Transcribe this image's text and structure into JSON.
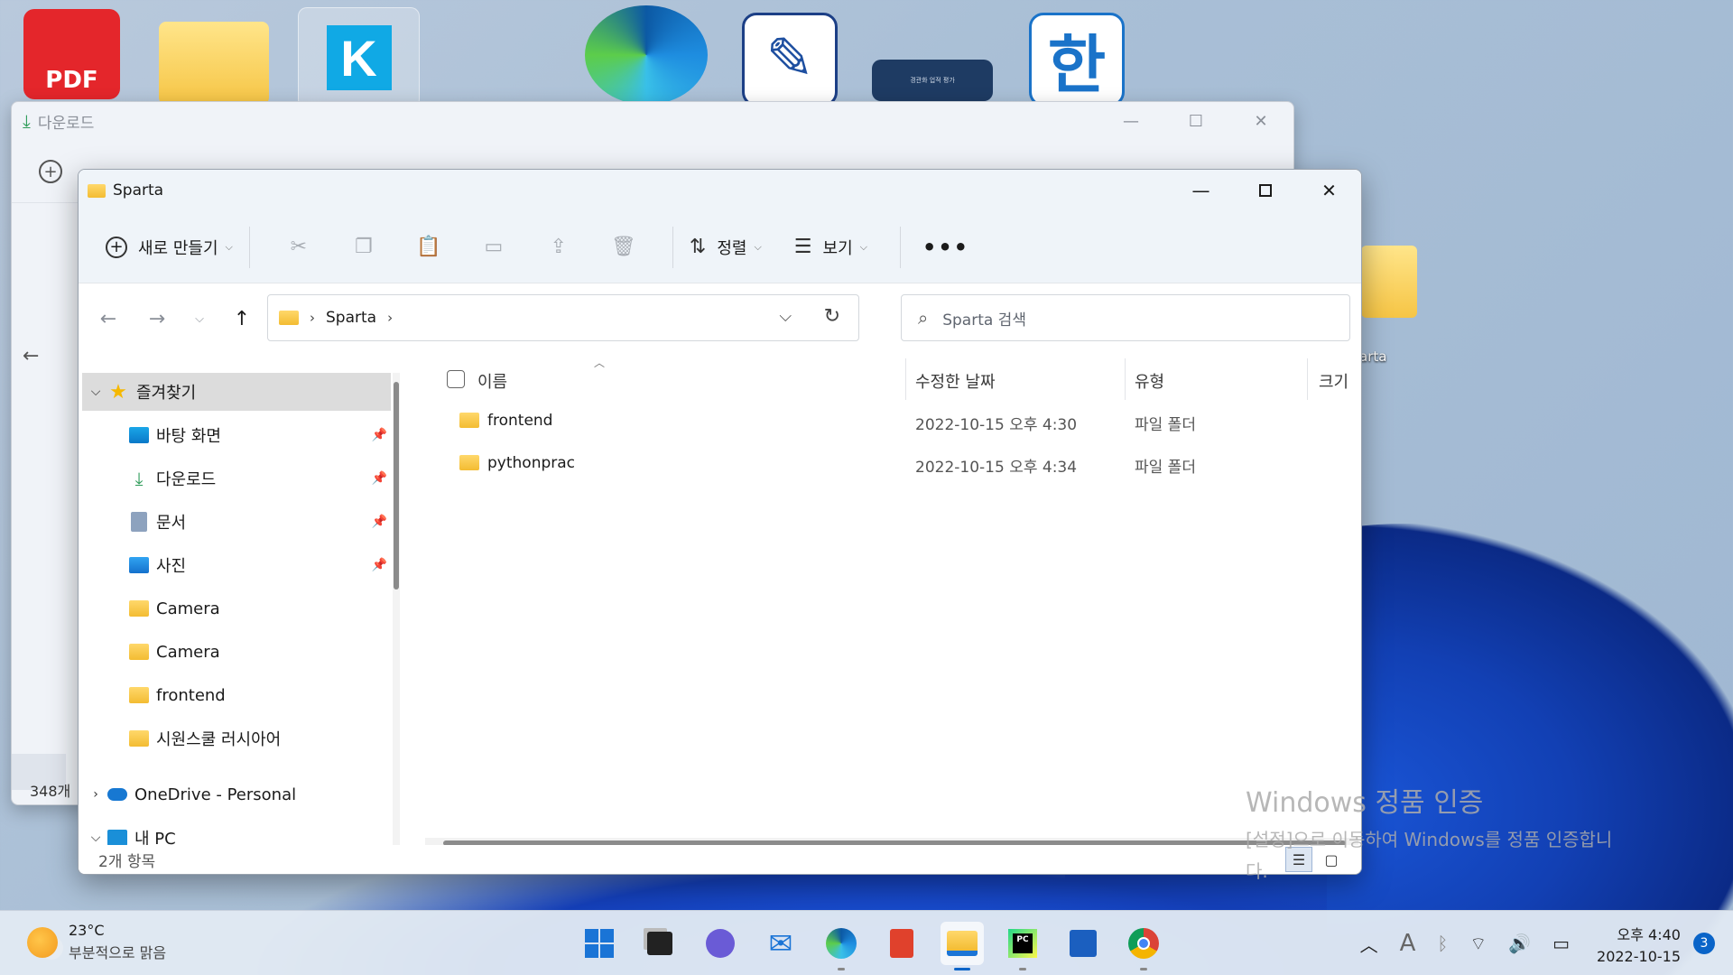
{
  "desktop": {
    "icons": [
      {
        "name": "pdf-app",
        "label": "PDF"
      },
      {
        "name": "folder"
      },
      {
        "name": "k-app",
        "label": "K"
      },
      {
        "name": "edge"
      },
      {
        "name": "notepad"
      },
      {
        "name": "doc-thumbnail",
        "label": "경관화 업적 평가"
      },
      {
        "name": "hancom",
        "label": "한"
      }
    ],
    "sparta_folder_label": "arta"
  },
  "back_window": {
    "title": "다운로드",
    "item_count": "348개"
  },
  "window": {
    "title": "Sparta",
    "command_bar": {
      "new_label": "새로 만들기",
      "sort_label": "정렬",
      "view_label": "보기",
      "more_label": "•••"
    },
    "address": {
      "crumbs": [
        "Sparta"
      ],
      "search_placeholder": "Sparta 검색"
    },
    "nav_pane": {
      "favorites_label": "즐겨찾기",
      "items": [
        {
          "label": "바탕 화면",
          "icon": "desktop-icon",
          "pinned": true
        },
        {
          "label": "다운로드",
          "icon": "download-icon",
          "pinned": true
        },
        {
          "label": "문서",
          "icon": "documents-icon",
          "pinned": true
        },
        {
          "label": "사진",
          "icon": "pictures-icon",
          "pinned": true
        },
        {
          "label": "Camera",
          "icon": "folder-icon",
          "pinned": false
        },
        {
          "label": "Camera",
          "icon": "folder-icon",
          "pinned": false
        },
        {
          "label": "frontend",
          "icon": "folder-icon",
          "pinned": false
        },
        {
          "label": "시원스쿨 러시아어",
          "icon": "folder-icon",
          "pinned": false
        }
      ],
      "onedrive_label": "OneDrive - Personal",
      "pc_label": "내 PC"
    },
    "columns": {
      "name": "이름",
      "modified": "수정한 날짜",
      "type": "유형",
      "size": "크기"
    },
    "files": [
      {
        "name": "frontend",
        "modified": "2022-10-15 오후 4:30",
        "type": "파일 폴더",
        "size": ""
      },
      {
        "name": "pythonprac",
        "modified": "2022-10-15 오후 4:34",
        "type": "파일 폴더",
        "size": ""
      }
    ],
    "status": "2개 항목"
  },
  "watermark": {
    "line1": "Windows 정품 인증",
    "line2": "[설정]으로 이동하여 Windows를 정품 인증합니",
    "line3": "다."
  },
  "taskbar": {
    "weather_temp": "23°C",
    "weather_desc": "부분적으로 맑음",
    "apps": [
      "start-icon",
      "task-view-icon",
      "chat-icon",
      "mail-icon",
      "edge-icon",
      "office-icon",
      "file-explorer-icon",
      "pycharm-icon",
      "store-icon",
      "chrome-icon"
    ],
    "clock_time": "오후 4:40",
    "clock_date": "2022-10-15",
    "notification_count": "3",
    "ime_label": "A"
  }
}
